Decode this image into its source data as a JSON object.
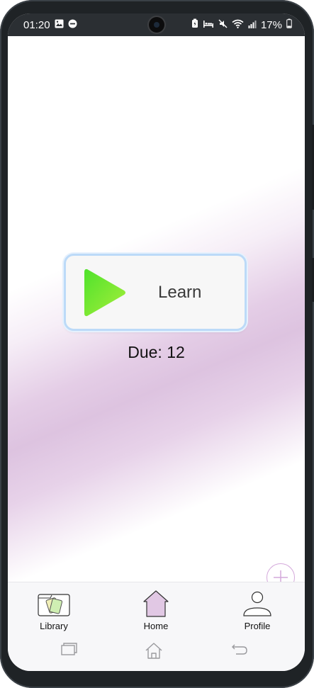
{
  "status_bar": {
    "time": "01:20",
    "battery": "17%",
    "left_icons": [
      "gallery-icon",
      "dnd-icon"
    ],
    "right_icons": [
      "battery-saver-icon",
      "sleep-icon",
      "mute-icon",
      "wifi-icon",
      "signal-icon",
      "battery-icon"
    ]
  },
  "main": {
    "learn_button_label": "Learn",
    "due_label": "Due: 12"
  },
  "fab": {
    "icon": "plus-icon"
  },
  "bottom_nav": {
    "items": [
      {
        "label": "Library",
        "icon": "library-cards-icon"
      },
      {
        "label": "Home",
        "icon": "home-icon",
        "selected": true
      },
      {
        "label": "Profile",
        "icon": "profile-icon"
      }
    ]
  },
  "system_nav": {
    "buttons": [
      "recents-icon",
      "home-outline-icon",
      "back-icon"
    ]
  },
  "colors": {
    "accent": "#bcdaf8",
    "play_gradient_start": "#4fe22c",
    "play_gradient_end": "#a6ee3a",
    "home_icon_fill": "#e1c8e4",
    "fab_border": "#d4a8db",
    "background_purple": "#ddc3e0"
  }
}
